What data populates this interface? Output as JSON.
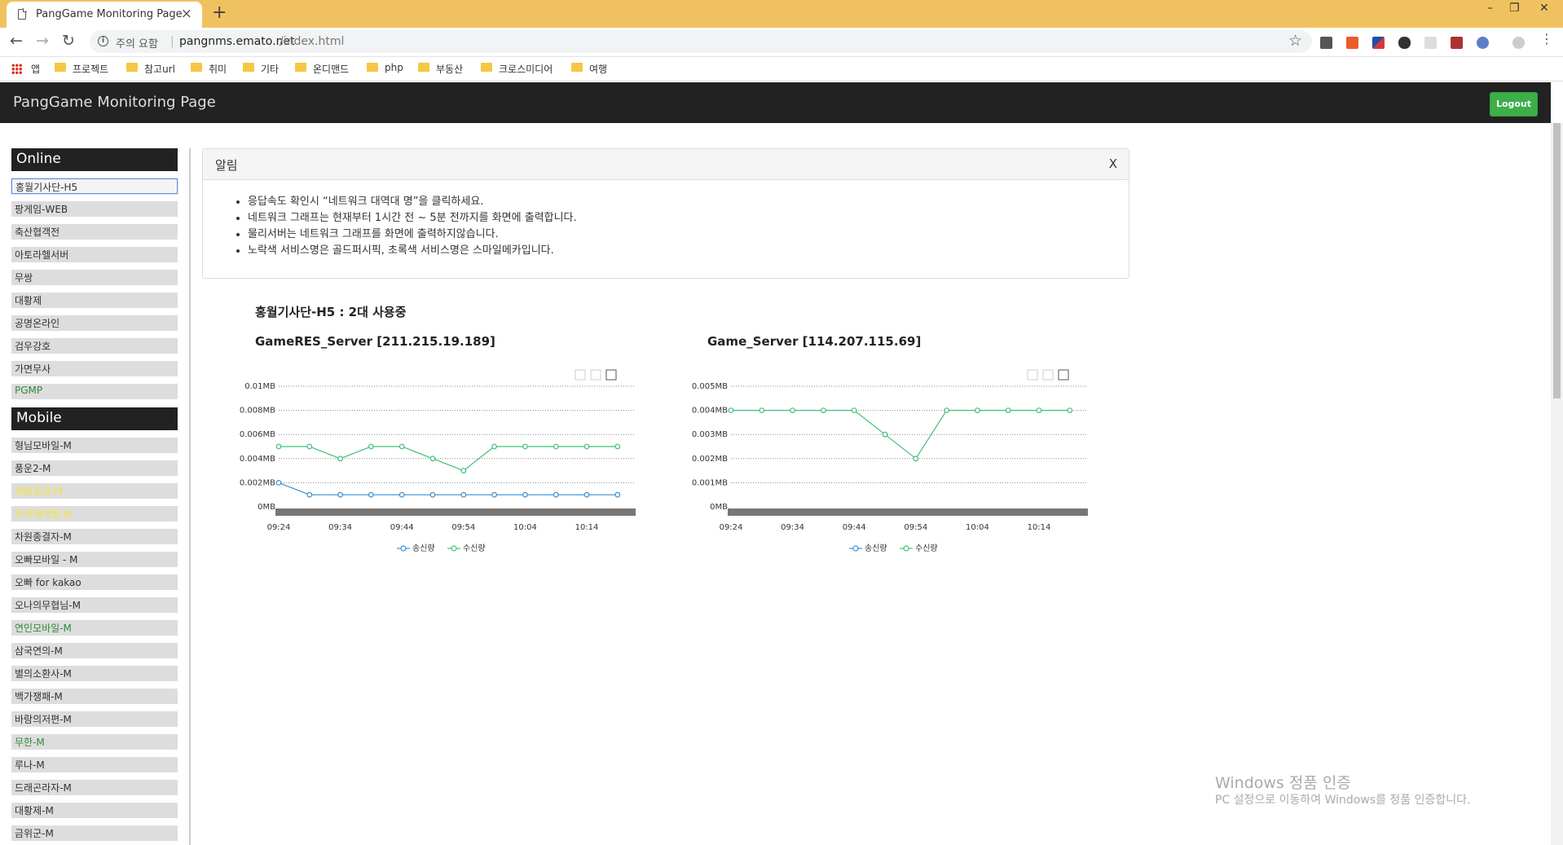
{
  "browser": {
    "tab_title": "PangGame Monitoring Page",
    "tab_close": "×",
    "new_tab": "+",
    "window_controls": [
      "–",
      "❐",
      "✕"
    ],
    "security_label": "주의 요함",
    "url_host": "pangnms.emato.net",
    "url_path": "/index.html",
    "bookmarks": [
      "앱",
      "프로젝트",
      "참고url",
      "취미",
      "기타",
      "온디맨드",
      "php",
      "부동산",
      "크로스미디어",
      "여행"
    ]
  },
  "app": {
    "title": "PangGame Monitoring Page",
    "logout_label": "Logout"
  },
  "sidebar": {
    "online_title": "Online",
    "online_items": [
      {
        "label": "홍월기사단-H5",
        "color": "normal",
        "selected": true
      },
      {
        "label": "팡게임-WEB",
        "color": "normal"
      },
      {
        "label": "축산협객전",
        "color": "normal"
      },
      {
        "label": "아토라헬서버",
        "color": "normal"
      },
      {
        "label": "무쌍",
        "color": "normal"
      },
      {
        "label": "대황제",
        "color": "normal"
      },
      {
        "label": "공명온라인",
        "color": "normal"
      },
      {
        "label": "검우강호",
        "color": "normal"
      },
      {
        "label": "가면무사",
        "color": "normal"
      },
      {
        "label": "PGMP",
        "color": "green"
      }
    ],
    "mobile_title": "Mobile",
    "mobile_items": [
      {
        "label": "형님모바일-M",
        "color": "normal"
      },
      {
        "label": "풍운2-M",
        "color": "normal"
      },
      {
        "label": "패왕일검-M",
        "color": "yellow"
      },
      {
        "label": "한국재개벌-M",
        "color": "yellow"
      },
      {
        "label": "차원종결자-M",
        "color": "normal"
      },
      {
        "label": "오빠모바일 - M",
        "color": "normal"
      },
      {
        "label": "오빠 for kakao",
        "color": "normal"
      },
      {
        "label": "오나의무협님-M",
        "color": "normal"
      },
      {
        "label": "연인모바일-M",
        "color": "green"
      },
      {
        "label": "삼국연의-M",
        "color": "normal"
      },
      {
        "label": "별의소환사-M",
        "color": "normal"
      },
      {
        "label": "백가쟁패-M",
        "color": "normal"
      },
      {
        "label": "바람의저편-M",
        "color": "normal"
      },
      {
        "label": "무한-M",
        "color": "green"
      },
      {
        "label": "루나-M",
        "color": "normal"
      },
      {
        "label": "드래곤라자-M",
        "color": "normal"
      },
      {
        "label": "대황제-M",
        "color": "normal"
      },
      {
        "label": "금위군-M",
        "color": "normal"
      }
    ]
  },
  "notice": {
    "title": "알림",
    "close_label": "X",
    "items": [
      "응답속도 확인시 “네트워크 대역대 명”을 클릭하세요.",
      "네트워크 그래프는 현재부터 1시간 전 ~ 5분 전까지를 화면에 출력합니다.",
      "물리서버는 네트워크 그래프를 화면에 출력하지않습니다.",
      "노락색 서비스명은 골드퍼시픽, 초록색 서비스명은 스마일메카입니다."
    ]
  },
  "main": {
    "group_title": "홍월기사단-H5 : 2대 사용중"
  },
  "colors": {
    "send_series": "#3a8fd1",
    "recv_series": "#3fc07a",
    "header_bg": "#222222",
    "logout_bg": "#3dae49"
  },
  "chart_data": [
    {
      "type": "line",
      "title": "GameRES_Server [211.215.19.189]",
      "y_ticks": [
        "0MB",
        "0.002MB",
        "0.004MB",
        "0.006MB",
        "0.008MB",
        "0.01MB"
      ],
      "ylim": [
        0,
        0.01
      ],
      "x_ticks": [
        "09:24",
        "09:34",
        "09:44",
        "09:54",
        "10:04",
        "10:14"
      ],
      "x": [
        "09:24",
        "09:29",
        "09:34",
        "09:39",
        "09:44",
        "09:49",
        "09:54",
        "09:59",
        "10:04",
        "10:09",
        "10:14",
        "10:19"
      ],
      "grid": "horizontal dotted",
      "legend": "bottom-center",
      "series": [
        {
          "name": "송신량",
          "values": [
            0.002,
            0.001,
            0.001,
            0.001,
            0.001,
            0.001,
            0.001,
            0.001,
            0.001,
            0.001,
            0.001,
            0.001
          ]
        },
        {
          "name": "수신량",
          "values": [
            0.005,
            0.005,
            0.004,
            0.005,
            0.005,
            0.004,
            0.003,
            0.005,
            0.005,
            0.005,
            0.005,
            0.005
          ]
        }
      ]
    },
    {
      "type": "line",
      "title": "Game_Server [114.207.115.69]",
      "y_ticks": [
        "0MB",
        "0.001MB",
        "0.002MB",
        "0.003MB",
        "0.004MB",
        "0.005MB"
      ],
      "ylim": [
        0,
        0.005
      ],
      "x_ticks": [
        "09:24",
        "09:34",
        "09:44",
        "09:54",
        "10:04",
        "10:14"
      ],
      "x": [
        "09:24",
        "09:29",
        "09:34",
        "09:39",
        "09:44",
        "09:49",
        "09:54",
        "09:59",
        "10:04",
        "10:09",
        "10:14",
        "10:19"
      ],
      "grid": "horizontal dotted",
      "legend": "bottom-center",
      "series": [
        {
          "name": "송신량",
          "values": []
        },
        {
          "name": "수신량",
          "values": [
            0.004,
            0.004,
            0.004,
            0.004,
            0.004,
            0.003,
            0.002,
            0.004,
            0.004,
            0.004,
            0.004,
            0.004
          ]
        }
      ]
    }
  ],
  "watermark": {
    "line1": "Windows 정품 인증",
    "line2": "PC 설정으로 이동하여 Windows를 정품 인증합니다."
  }
}
